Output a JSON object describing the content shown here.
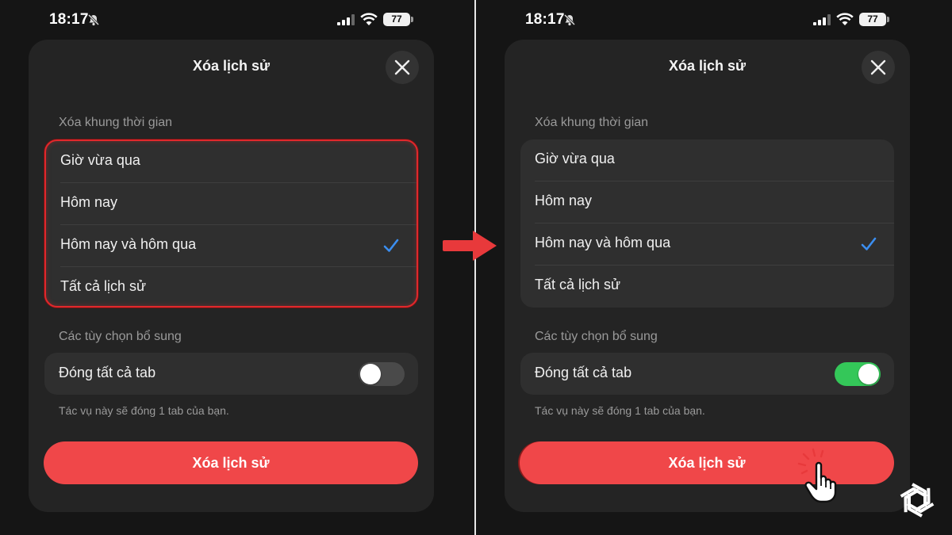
{
  "status_bar": {
    "time": "18:17",
    "battery": "77"
  },
  "sheet": {
    "title": "Xóa lịch sử",
    "timeframe_label": "Xóa khung thời gian",
    "timeframe_options": [
      {
        "label": "Giờ vừa qua",
        "selected": false
      },
      {
        "label": "Hôm nay",
        "selected": false
      },
      {
        "label": "Hôm nay và hôm qua",
        "selected": true
      },
      {
        "label": "Tất cả lịch sử",
        "selected": false
      }
    ],
    "options_label": "Các tùy chọn bổ sung",
    "close_tabs_label": "Đóng tất cả tab",
    "note": "Tác vụ này sẽ đóng 1 tab của bạn.",
    "clear_button": "Xóa lịch sử"
  },
  "steps": [
    {
      "toggle_on": false,
      "highlight": "timeframe-list"
    },
    {
      "toggle_on": true,
      "highlight": "clear-button"
    }
  ],
  "colors": {
    "accent_red": "#f04749",
    "highlight_red": "#e0282c",
    "toggle_on": "#34c759",
    "check_blue": "#3b8ef0"
  },
  "icons": [
    "bell-slash-icon",
    "signal-icon",
    "wifi-icon",
    "close-icon",
    "checkmark-icon",
    "arrow-right-icon",
    "hand-pointer-icon",
    "openai-logo"
  ]
}
